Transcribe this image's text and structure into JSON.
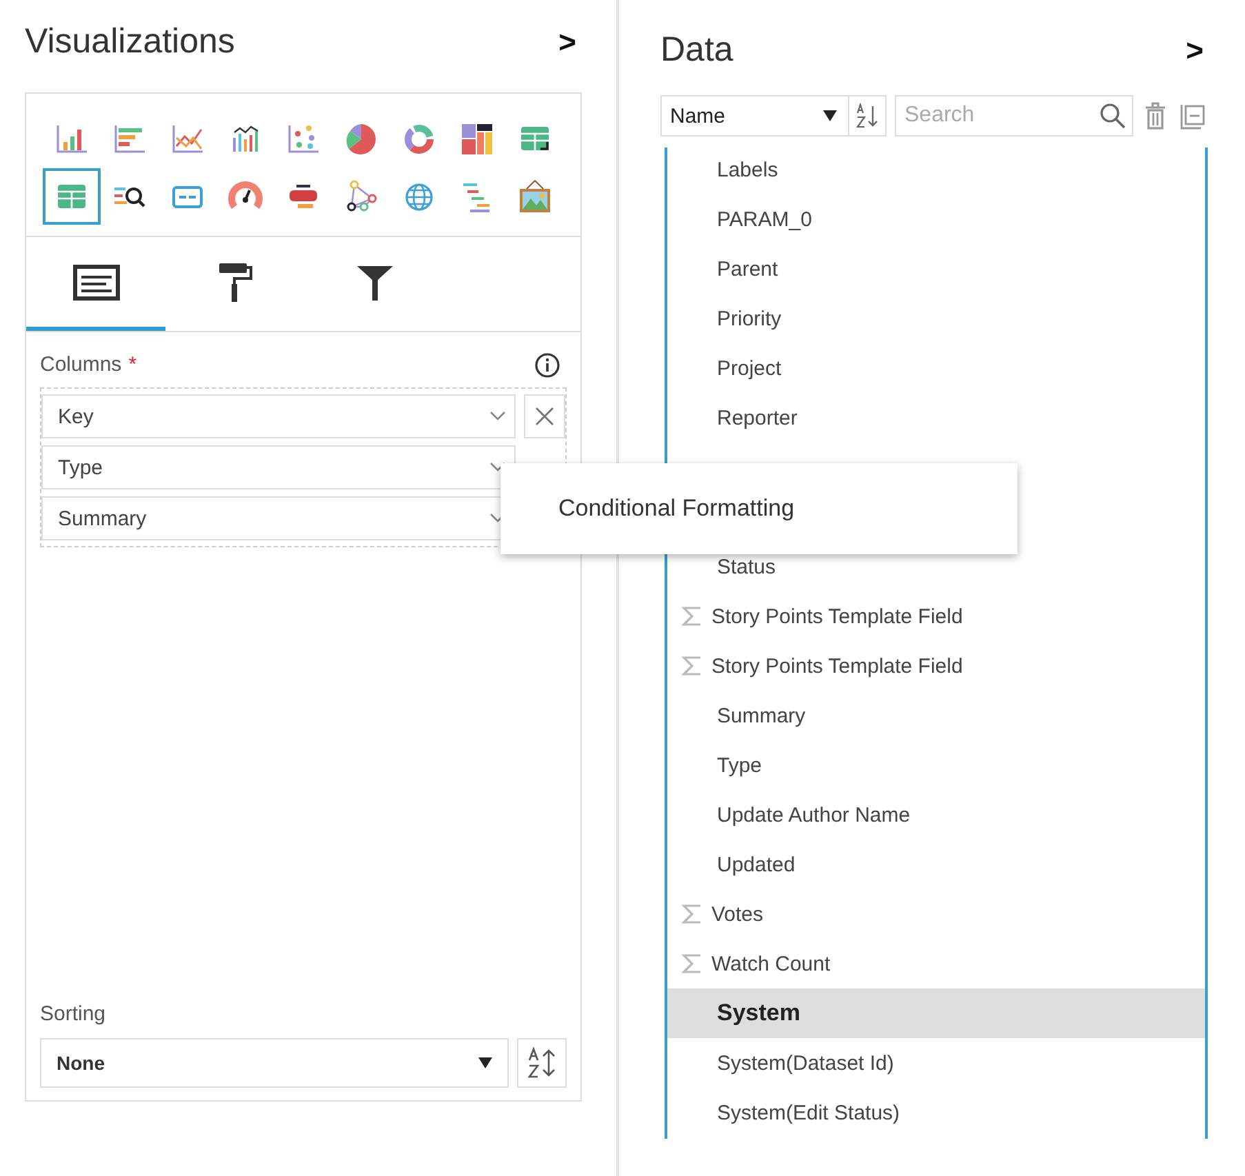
{
  "visualizations": {
    "title": "Visualizations",
    "expand": ">",
    "chart_types": [
      {
        "kind": "bar",
        "selected": false
      },
      {
        "kind": "hbar",
        "selected": false
      },
      {
        "kind": "line",
        "selected": false
      },
      {
        "kind": "combo",
        "selected": false
      },
      {
        "kind": "scatter",
        "selected": false
      },
      {
        "kind": "pie",
        "selected": false
      },
      {
        "kind": "donut",
        "selected": false
      },
      {
        "kind": "treemap",
        "selected": false
      },
      {
        "kind": "pivot",
        "selected": false
      },
      {
        "kind": "table",
        "selected": true
      },
      {
        "kind": "search",
        "selected": false
      },
      {
        "kind": "card",
        "selected": false
      },
      {
        "kind": "gauge",
        "selected": false
      },
      {
        "kind": "wordcloud",
        "selected": false
      },
      {
        "kind": "network",
        "selected": false
      },
      {
        "kind": "globe",
        "selected": false
      },
      {
        "kind": "gantt",
        "selected": false
      },
      {
        "kind": "image",
        "selected": false
      }
    ],
    "tabs": [
      {
        "kind": "fields",
        "selected": true
      },
      {
        "kind": "format",
        "selected": false
      },
      {
        "kind": "filter",
        "selected": false
      }
    ],
    "columns_label": "Columns",
    "required_mark": "*",
    "columns": [
      {
        "value": "Key",
        "remove_button": true
      },
      {
        "value": "Type",
        "remove_button": false
      },
      {
        "value": "Summary",
        "remove_button": false
      }
    ],
    "sorting_label": "Sorting",
    "sorting_value": "None"
  },
  "data": {
    "title": "Data",
    "expand": ">",
    "sort_by": "Name",
    "search": {
      "placeholder": "Search"
    },
    "fields": [
      {
        "name": "Labels",
        "kind": "field",
        "measure": false,
        "selected": false
      },
      {
        "name": "PARAM_0",
        "kind": "field",
        "measure": false,
        "selected": false
      },
      {
        "name": "Parent",
        "kind": "field",
        "measure": false,
        "selected": false
      },
      {
        "name": "Priority",
        "kind": "field",
        "measure": false,
        "selected": false
      },
      {
        "name": "Project",
        "kind": "field",
        "measure": false,
        "selected": false
      },
      {
        "name": "Reporter",
        "kind": "field",
        "measure": false,
        "selected": false
      },
      {
        "kind": "covered"
      },
      {
        "kind": "covered"
      },
      {
        "name": "Status",
        "kind": "field",
        "measure": false,
        "selected": false
      },
      {
        "name": "Story Points Template Field",
        "kind": "field",
        "measure": true,
        "selected": false
      },
      {
        "name": "Story Points Template Field",
        "kind": "field",
        "measure": true,
        "selected": false
      },
      {
        "name": "Summary",
        "kind": "field",
        "measure": false,
        "selected": false
      },
      {
        "name": "Type",
        "kind": "field",
        "measure": false,
        "selected": false
      },
      {
        "name": "Update Author Name",
        "kind": "field",
        "measure": false,
        "selected": false
      },
      {
        "name": "Updated",
        "kind": "field",
        "measure": false,
        "selected": false
      },
      {
        "name": "Votes",
        "kind": "field",
        "measure": true,
        "selected": false
      },
      {
        "name": "Watch Count",
        "kind": "field",
        "measure": true,
        "selected": false
      },
      {
        "name": "System",
        "kind": "field",
        "measure": false,
        "selected": true
      },
      {
        "name": "System(Dataset Id)",
        "kind": "field",
        "measure": false,
        "selected": false
      },
      {
        "name": "System(Edit Status)",
        "kind": "field",
        "measure": false,
        "selected": false
      }
    ]
  },
  "context_menu": {
    "items": [
      "Conditional Formatting"
    ]
  }
}
